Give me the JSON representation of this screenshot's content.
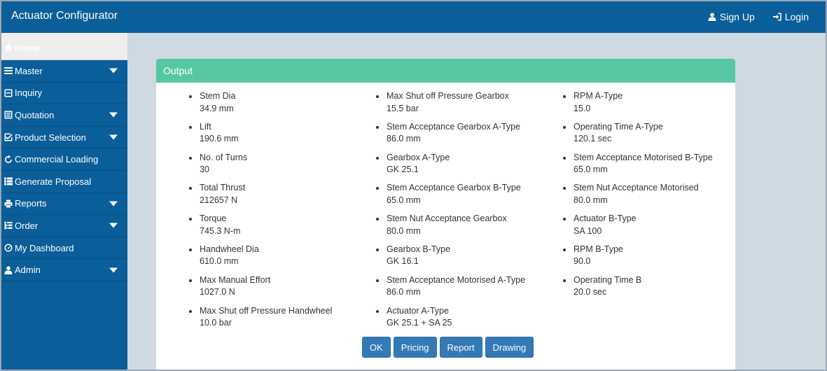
{
  "app": {
    "title": "Actuator Configurator"
  },
  "nav": {
    "signup": "Sign Up",
    "login": "Login"
  },
  "sidebar": {
    "items": [
      {
        "label": "Home",
        "icon": "home-icon"
      },
      {
        "label": "Master",
        "icon": "menu-icon",
        "has_caret": true
      },
      {
        "label": "Inquiry",
        "icon": "inquiry-icon"
      },
      {
        "label": "Quotation",
        "icon": "document-icon",
        "has_caret": true
      },
      {
        "label": "Product Selection",
        "icon": "check-square-icon",
        "has_caret": true
      },
      {
        "label": "Commercial Loading",
        "icon": "refresh-icon"
      },
      {
        "label": "Generate Proposal",
        "icon": "list-icon"
      },
      {
        "label": "Reports",
        "icon": "printer-icon",
        "has_caret": true
      },
      {
        "label": "Order",
        "icon": "tree-icon",
        "has_caret": true
      },
      {
        "label": "My Dashboard",
        "icon": "dashboard-icon"
      },
      {
        "label": "Admin",
        "icon": "user-icon",
        "has_caret": true
      }
    ]
  },
  "panel": {
    "title": "Output",
    "columns": [
      [
        {
          "label": "Stem Dia",
          "value": "34.9 mm"
        },
        {
          "label": "Lift",
          "value": "190.6 mm"
        },
        {
          "label": "No. of Turns",
          "value": "30"
        },
        {
          "label": "Total Thrust",
          "value": "212657 N"
        },
        {
          "label": "Torque",
          "value": "745.3 N-m"
        },
        {
          "label": "Handwheel Dia",
          "value": "610.0 mm"
        },
        {
          "label": "Max Manual Effort",
          "value": "1027.0 N"
        },
        {
          "label": "Max Shut off Pressure Handwheel",
          "value": "10.0 bar"
        }
      ],
      [
        {
          "label": "Max Shut off Pressure Gearbox",
          "value": "15.5 bar"
        },
        {
          "label": "Stem Acceptance Gearbox A-Type",
          "value": "86.0 mm"
        },
        {
          "label": "Gearbox A-Type",
          "value": "GK 25.1"
        },
        {
          "label": "Stem Acceptance Gearbox B-Type",
          "value": "65.0 mm"
        },
        {
          "label": "Stem Nut Acceptance Gearbox",
          "value": "80.0 mm"
        },
        {
          "label": "Gearbox B-Type",
          "value": "GK 16.1"
        },
        {
          "label": "Stem Acceptance Motorised A-Type",
          "value": "86.0 mm"
        },
        {
          "label": "Actuator A-Type",
          "value": "GK 25.1 + SA 25"
        }
      ],
      [
        {
          "label": "RPM A-Type",
          "value": "15.0"
        },
        {
          "label": "Operating Time A-Type",
          "value": "120.1 sec"
        },
        {
          "label": "Stem Acceptance Motorised B-Type",
          "value": "65.0 mm"
        },
        {
          "label": "Stem Nut Acceptance Motorised",
          "value": "80.0 mm"
        },
        {
          "label": "Actuator B-Type",
          "value": "SA 100"
        },
        {
          "label": "RPM B-Type",
          "value": "90.0"
        },
        {
          "label": "Operating Time B",
          "value": "20.0 sec"
        }
      ]
    ],
    "buttons": [
      "OK",
      "Pricing",
      "Report",
      "Drawing"
    ]
  },
  "colors": {
    "primary": "#0a5e99",
    "panel_heading": "#55c8a3",
    "button": "#337ab7",
    "background": "#ced9e2"
  }
}
